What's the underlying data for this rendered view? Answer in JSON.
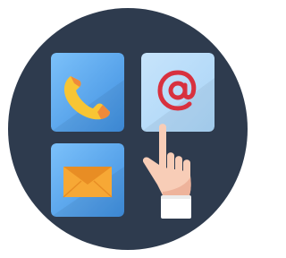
{
  "colors": {
    "background_circle": "#2e3b4e",
    "tile_blue": "#4ea4f2",
    "tile_blue_light": "#7cc1fa",
    "tile_blue_dark": "#3f8fe0",
    "email_tile": "#a9d4f7",
    "email_tile_light": "#c7e4fb",
    "at_sign": "#d8313f",
    "phone_yellow": "#f8c534",
    "phone_orange": "#ef8a3a",
    "envelope": "#f7a835",
    "envelope_dark": "#e88d24",
    "skin": "#f8cdb7",
    "skin_shadow": "#eeb39b",
    "cuff": "#ffffff"
  },
  "icons": {
    "phone": "phone-icon",
    "email": "at-sign-icon",
    "mail": "envelope-icon",
    "hand": "pointing-hand-icon"
  }
}
